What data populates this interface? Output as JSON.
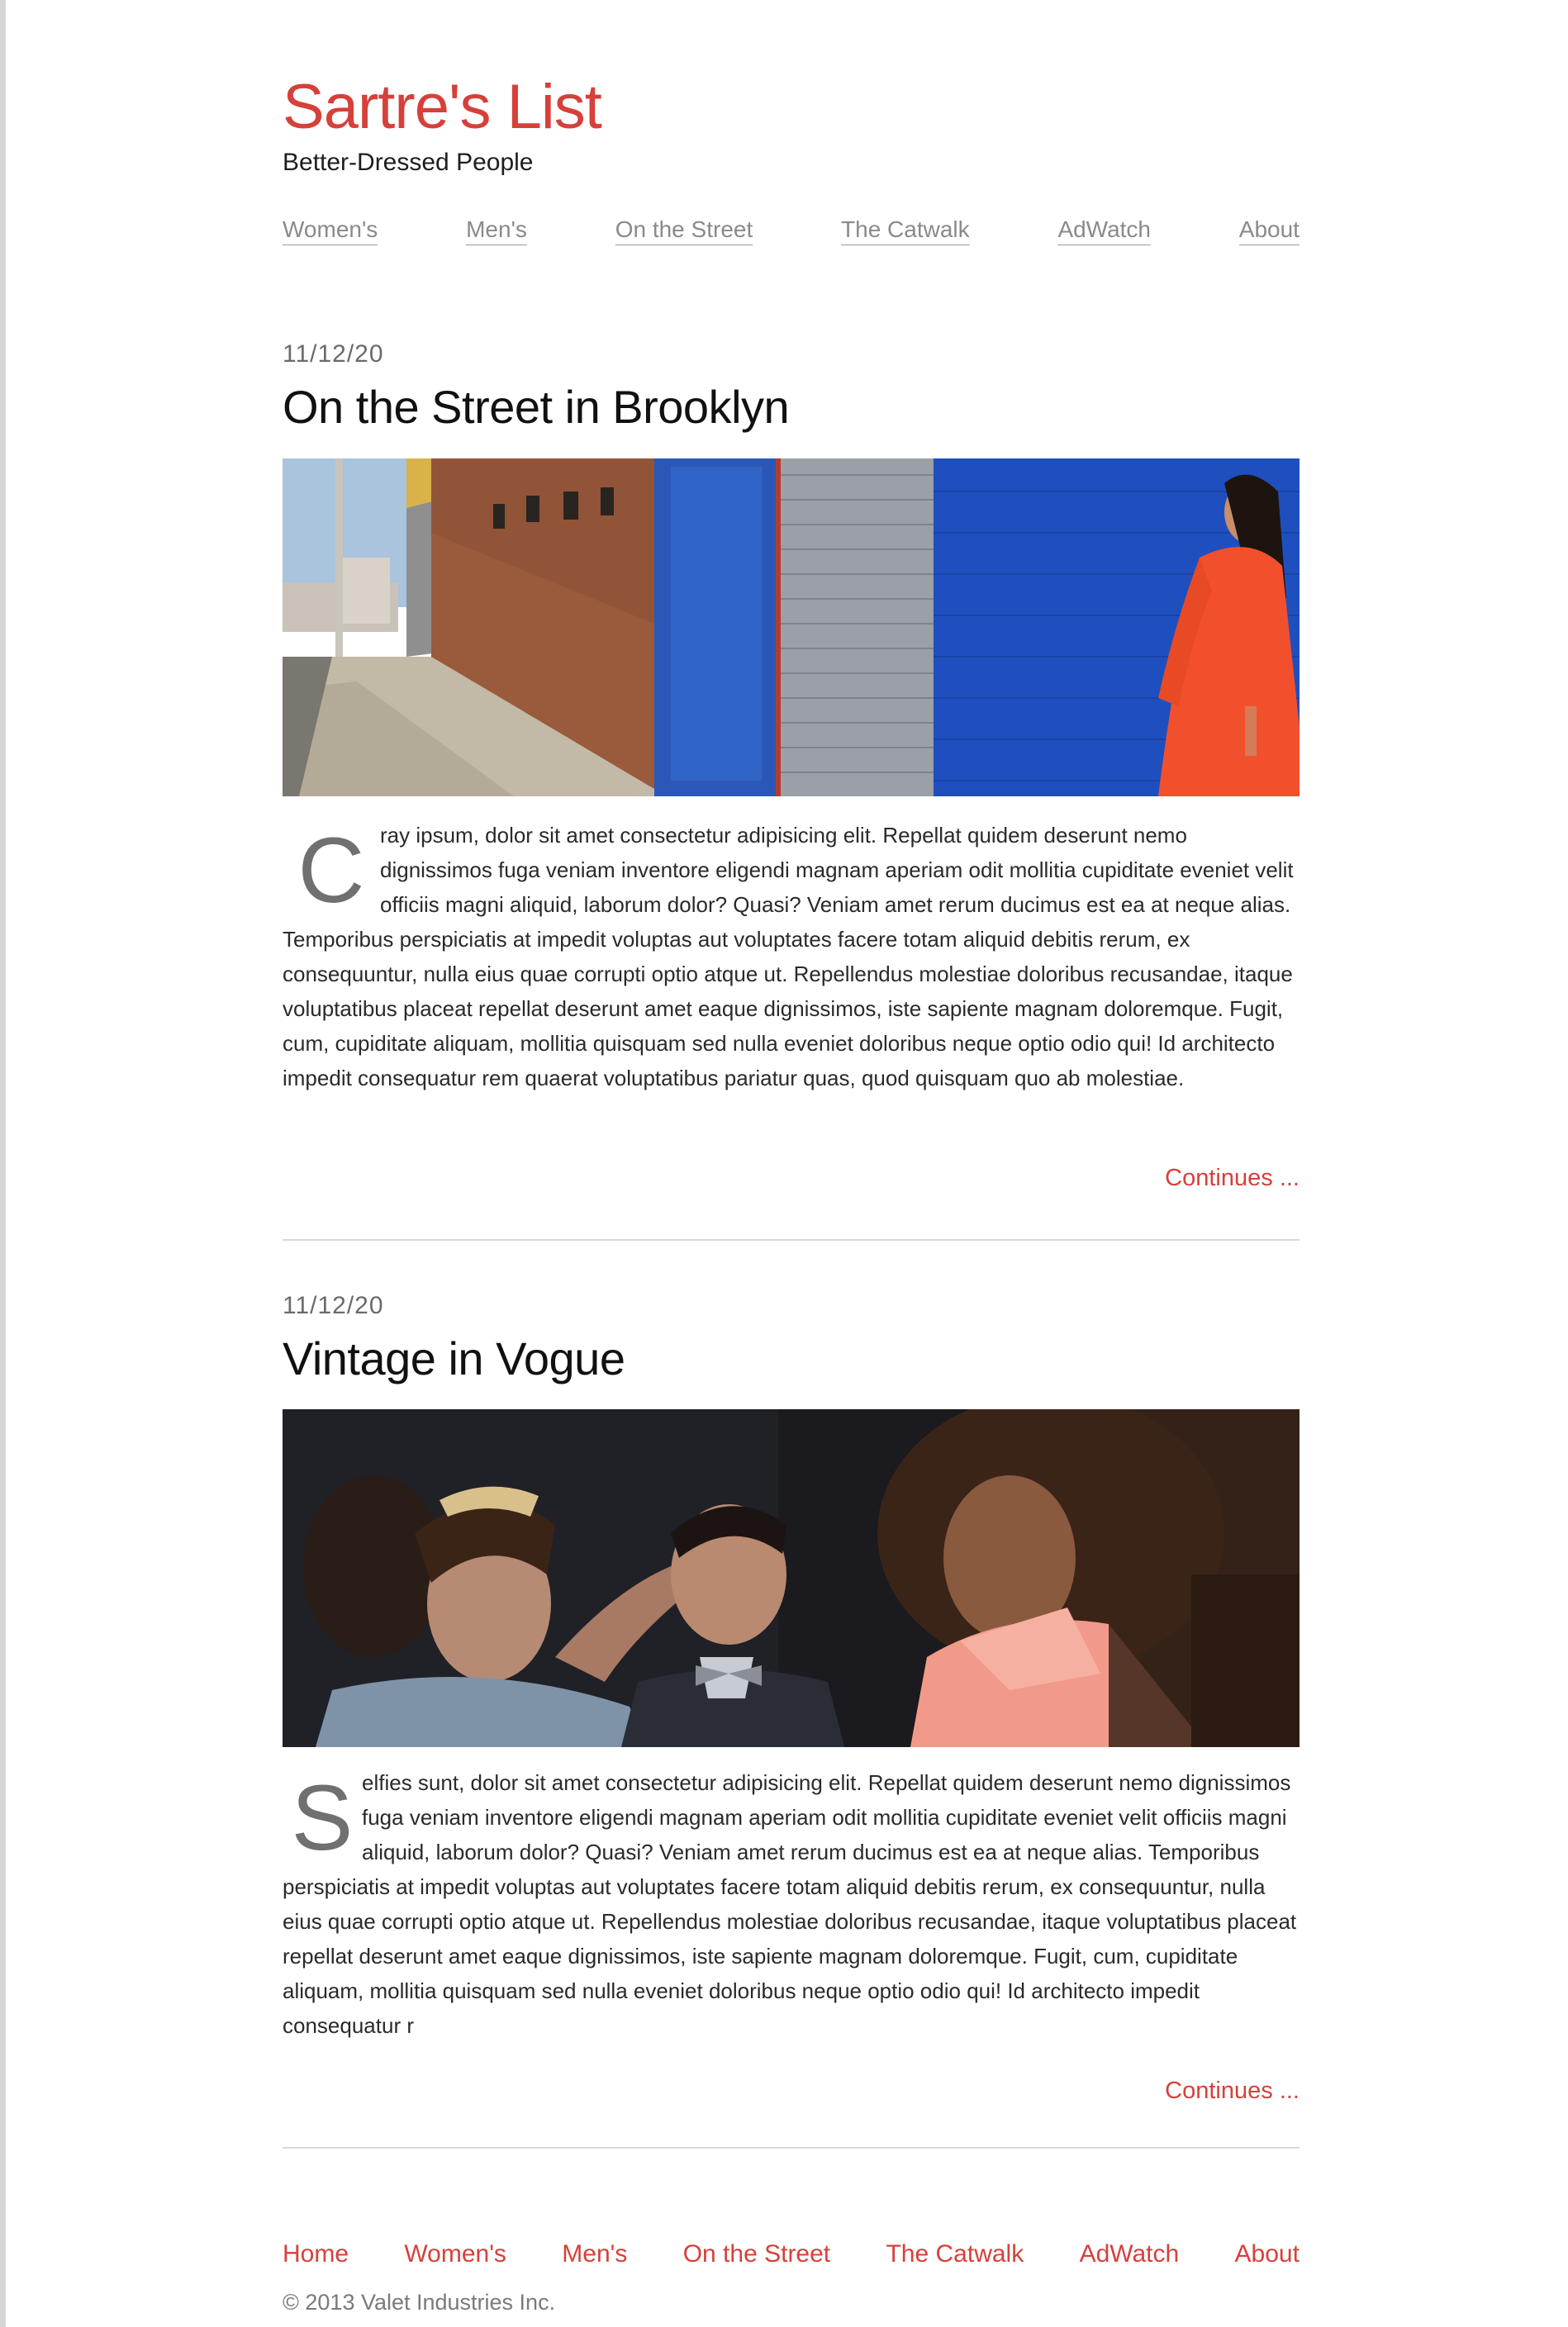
{
  "site": {
    "title": "Sartre's List",
    "tagline": "Better-Dressed People"
  },
  "nav": {
    "items": [
      "Women's",
      "Men's",
      "On the Street",
      "The Catwalk",
      "AdWatch",
      "About"
    ]
  },
  "posts": [
    {
      "date": "11/12/20",
      "title": "On the Street in Brooklyn",
      "image_alt": "street photo: woman in orange dress against blue wall",
      "dropcap": "C",
      "body": "ray ipsum, dolor sit amet consectetur adipisicing elit. Repellat quidem deserunt nemo dignissimos fuga veniam inventore eligendi magnam aperiam odit mollitia cupiditate eveniet velit officiis magni aliquid, laborum dolor? Quasi? Veniam amet rerum ducimus est ea at neque alias. Temporibus perspiciatis at impedit voluptas aut voluptates facere totam aliquid debitis rerum, ex consequuntur, nulla eius quae corrupti optio atque ut. Repellendus molestiae doloribus recusandae, itaque voluptatibus placeat repellat deserunt amet eaque dignissimos, iste sapiente magnam doloremque. Fugit, cum, cupiditate aliquam, mollitia quisquam sed nulla eveniet doloribus neque optio odio qui! Id architecto impedit consequatur rem quaerat voluptatibus pariatur quas, quod quisquam quo ab molestiae.",
      "continues": "Continues ..."
    },
    {
      "date": "11/12/20",
      "title": "Vintage in Vogue",
      "image_alt": "three people photographed at night",
      "dropcap": "S",
      "body": "elfies sunt, dolor sit amet consectetur adipisicing elit. Repellat quidem deserunt nemo dignissimos fuga veniam inventore eligendi magnam aperiam odit mollitia cupiditate eveniet velit officiis magni aliquid, laborum dolor? Quasi? Veniam amet rerum ducimus est ea at neque alias. Temporibus perspiciatis at impedit voluptas aut voluptates facere totam aliquid debitis rerum, ex consequuntur, nulla eius quae corrupti optio atque ut. Repellendus molestiae doloribus recusandae, itaque voluptatibus placeat repellat deserunt amet eaque dignissimos, iste sapiente magnam doloremque. Fugit, cum, cupiditate aliquam, mollitia quisquam sed nulla eveniet doloribus neque optio odio qui! Id architecto impedit consequatur r",
      "continues": "Continues ..."
    }
  ],
  "footer": {
    "nav": [
      "Home",
      "Women's",
      "Men's",
      "On the Street",
      "The Catwalk",
      "AdWatch",
      "About"
    ],
    "copyright": "© 2013 Valet Industries Inc."
  },
  "colors": {
    "accent": "#d6403a",
    "nav_link": "#8a8a8a",
    "divider": "#d8d8d8"
  }
}
